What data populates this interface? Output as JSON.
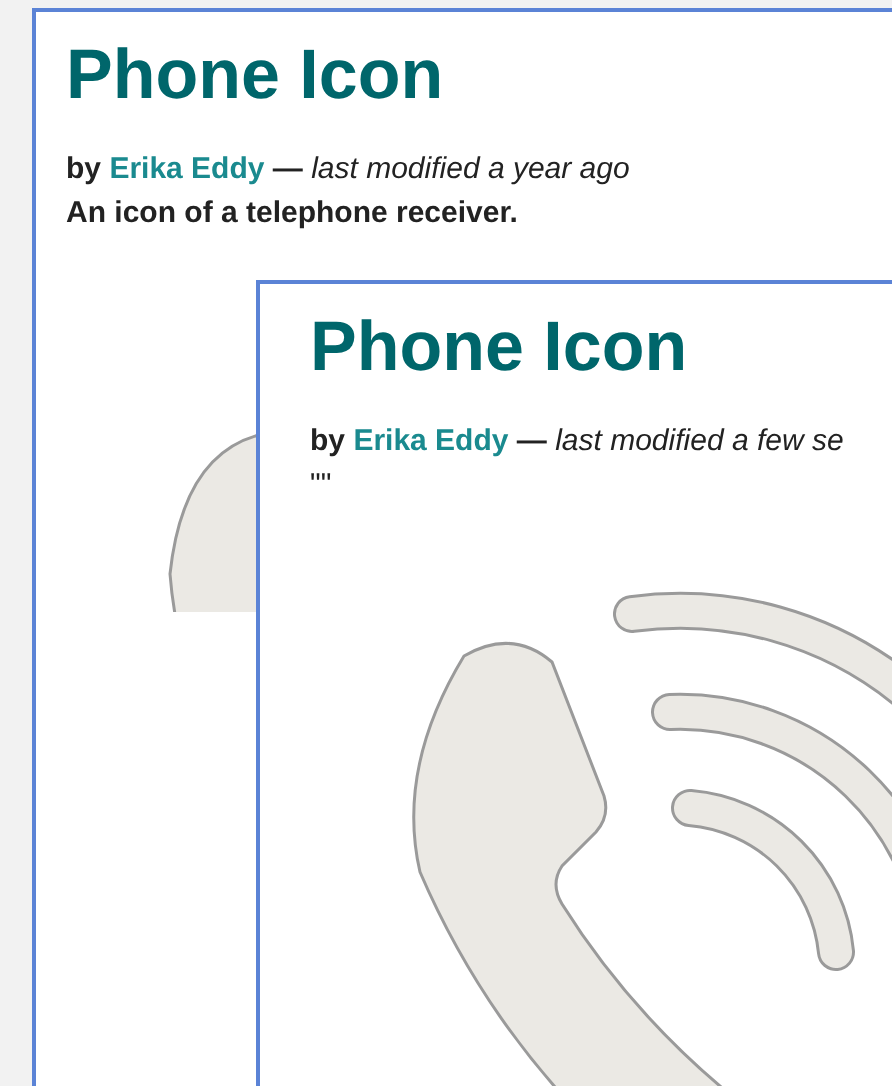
{
  "page": {
    "title": "Phone Icon",
    "by_label": "by",
    "author": "Erika Eddy",
    "separator": "—",
    "modified": "last modified a year ago",
    "description": "An icon of a telephone receiver.",
    "preview": {
      "title": "Phone Icon",
      "by_label": "by",
      "author": "Erika Eddy",
      "separator": "—",
      "modified": "last modified a few se",
      "description": "\"\""
    }
  }
}
